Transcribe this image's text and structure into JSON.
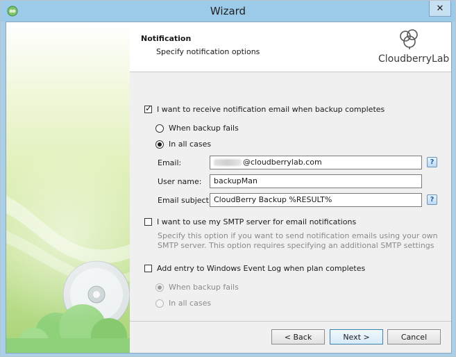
{
  "window": {
    "title": "Wizard",
    "close_glyph": "✕"
  },
  "icons": {
    "app": "cloudberry-app-icon",
    "close": "close-icon",
    "logo": "cloudberry-logo-icon",
    "help": "help-icon"
  },
  "header": {
    "title": "Notification",
    "subtitle": "Specify notification options",
    "logo_text": "CloudberryLab"
  },
  "notify": {
    "label": "I want to receive notification email when backup completes",
    "checked": true,
    "radio_fails": "When backup fails",
    "radio_all": "In all cases",
    "selected": "all",
    "email_label": "Email:",
    "email_value": "@cloudberrylab.com",
    "username_label": "User name:",
    "username_value": "backupMan",
    "subject_label": "Email subject:",
    "subject_value": "CloudBerry Backup %RESULT%",
    "help_glyph": "?"
  },
  "smtp": {
    "label": "I want to use my SMTP server for email notifications",
    "checked": false,
    "description": "Specify this option if you want to send notification emails using your own SMTP server. This option requires specifying an additional SMTP settings"
  },
  "eventlog": {
    "label": "Add entry to Windows Event Log when plan completes",
    "checked": false,
    "radio_fails": "When backup fails",
    "radio_all": "In all cases",
    "selected": "fails"
  },
  "buttons": {
    "back": "< Back",
    "next": "Next >",
    "cancel": "Cancel"
  },
  "colors": {
    "titlebar": "#9ccbea",
    "accent": "#3c7fb1"
  }
}
